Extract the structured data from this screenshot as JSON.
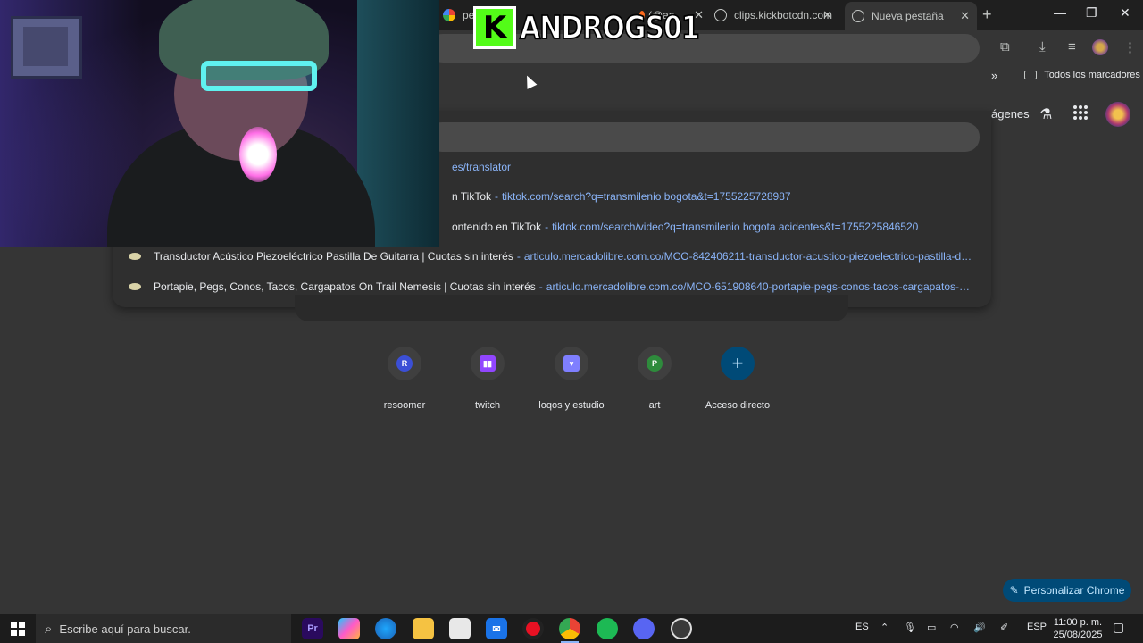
{
  "tabs": [
    {
      "title": "pe",
      "active": false
    },
    {
      "title": "(@an",
      "active": false
    },
    {
      "title": "clips.kickbotcdn.com",
      "active": false
    },
    {
      "title": "Nueva pestaña",
      "active": true
    }
  ],
  "bookmarks": {
    "all_label": "Todos los marcadores"
  },
  "ntp_header": {
    "images_label": "ágenes"
  },
  "suggestions": [
    {
      "title": "",
      "url": "es/translator"
    },
    {
      "title": "n TikTok",
      "url": "tiktok.com/search?q=transmilenio bogota&t=1755225728987"
    },
    {
      "title": "ontenido en TikTok",
      "url": "tiktok.com/search/video?q=transmilenio bogota acidentes&t=1755225846520"
    },
    {
      "title": "Transductor Acústico Piezoeléctrico Pastilla De Guitarra | Cuotas sin interés",
      "url": "articulo.mercadolibre.com.co/MCO-842406211-transductor-acustico-piezoelectrico-pastilla-de-guit..."
    },
    {
      "title": "Portapie, Pegs, Conos, Tacos, Cargapatos On Trail Nemesis | Cuotas sin interés",
      "url": "articulo.mercadolibre.com.co/MCO-651908640-portapie-pegs-conos-tacos-cargapatos-on-trail-..."
    }
  ],
  "shortcuts": [
    {
      "label": "resoomer",
      "badge": "R",
      "color": "#3b4fd6"
    },
    {
      "label": "twitch",
      "badge": "",
      "color": "#9146ff"
    },
    {
      "label": "loqos y estudio",
      "badge": "",
      "color": "#7f7fff"
    },
    {
      "label": "art",
      "badge": "P",
      "color": "#2e8b3c"
    },
    {
      "label": "Acceso directo",
      "badge": "+",
      "color": "#004a77"
    }
  ],
  "customize_label": "Personalizar Chrome",
  "overlay": {
    "kick_logo": "K",
    "channel_name": "ANDROGS01"
  },
  "taskbar": {
    "search_placeholder": "Escribe aquí para buscar.",
    "apps": [
      "premiere",
      "copilot",
      "edge",
      "file-explorer",
      "store",
      "mail",
      "obs",
      "chrome",
      "spotify",
      "discord",
      "app"
    ],
    "lang_indicator": "ES",
    "keyboard_layout": "ESP",
    "time": "11:00 p. m.",
    "date": "25/08/2025"
  },
  "colors": {
    "accent": "#8ab4f8",
    "kick_green": "#53fc18",
    "customize_bg": "#004a77"
  }
}
